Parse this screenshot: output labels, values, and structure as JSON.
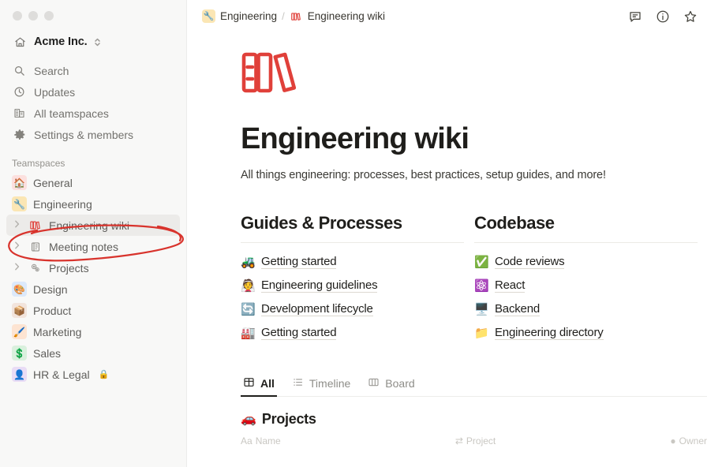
{
  "window": {
    "traffic_lights": [
      "close",
      "minimize",
      "maximize"
    ]
  },
  "sidebar": {
    "workspace": {
      "name": "Acme Inc.",
      "icon": "house-icon",
      "switcher_icon": "chevron-updown-icon"
    },
    "nav": [
      {
        "label": "Search",
        "icon": "search-icon"
      },
      {
        "label": "Updates",
        "icon": "clock-icon"
      },
      {
        "label": "All teamspaces",
        "icon": "buildings-icon"
      },
      {
        "label": "Settings & members",
        "icon": "gear-icon"
      }
    ],
    "teamspaces_label": "Teamspaces",
    "teamspaces": [
      {
        "label": "General",
        "emoji": "🏠",
        "badge_color": "#fce0de",
        "caret": false,
        "selected": false,
        "locked": false
      },
      {
        "label": "Engineering",
        "emoji": "🔧",
        "badge_color": "#fbe6b4",
        "caret": false,
        "selected": false,
        "locked": false
      },
      {
        "label": "Engineering wiki",
        "emoji": "📚",
        "badge_color": "",
        "caret": true,
        "selected": true,
        "locked": false
      },
      {
        "label": "Meeting notes",
        "emoji": "📔",
        "badge_color": "",
        "caret": true,
        "selected": false,
        "locked": false
      },
      {
        "label": "Projects",
        "emoji": "⚙️",
        "badge_color": "",
        "caret": true,
        "selected": false,
        "locked": false
      },
      {
        "label": "Design",
        "emoji": "🎨",
        "badge_color": "#dce9fb",
        "caret": false,
        "selected": false,
        "locked": false
      },
      {
        "label": "Product",
        "emoji": "📦",
        "badge_color": "#f2e4dc",
        "caret": false,
        "selected": false,
        "locked": false
      },
      {
        "label": "Marketing",
        "emoji": "🖌️",
        "badge_color": "#fde4d2",
        "caret": false,
        "selected": false,
        "locked": false
      },
      {
        "label": "Sales",
        "emoji": "💲",
        "badge_color": "#d9f0dd",
        "caret": false,
        "selected": false,
        "locked": false
      },
      {
        "label": "HR & Legal",
        "emoji": "👤",
        "badge_color": "#e9dcf5",
        "caret": false,
        "selected": false,
        "locked": true
      }
    ]
  },
  "annotation": {
    "shape": "hand-drawn-ellipse",
    "color": "#d8332c",
    "targets": "Engineering wiki sidebar item"
  },
  "topbar": {
    "breadcrumb": [
      {
        "label": "Engineering",
        "emoji": "🔧",
        "badge_color": "#fbe6b4"
      },
      {
        "label": "Engineering wiki",
        "emoji": "📚",
        "badge_color": ""
      }
    ],
    "separator": "/",
    "icons": [
      {
        "name": "comment-icon"
      },
      {
        "name": "info-icon"
      },
      {
        "name": "star-icon"
      }
    ]
  },
  "page": {
    "icon": "red-books-icon",
    "title": "Engineering wiki",
    "description": "All things engineering: processes, best practices, setup guides, and more!"
  },
  "columns": [
    {
      "heading": "Guides & Processes",
      "links": [
        {
          "label": "Getting started",
          "emoji": "🚜"
        },
        {
          "label": "Engineering guidelines",
          "emoji": "👰"
        },
        {
          "label": "Development lifecycle",
          "emoji": "🔄"
        },
        {
          "label": "Getting started",
          "emoji": "🏭"
        }
      ]
    },
    {
      "heading": "Codebase",
      "links": [
        {
          "label": "Code reviews",
          "emoji": "✅"
        },
        {
          "label": "React",
          "emoji": "⚛️"
        },
        {
          "label": "Backend",
          "emoji": "🖥️"
        },
        {
          "label": "Engineering directory",
          "emoji": "📁"
        }
      ]
    }
  ],
  "database": {
    "tabs": [
      {
        "label": "All",
        "icon": "grid-icon",
        "active": true
      },
      {
        "label": "Timeline",
        "icon": "timeline-icon",
        "active": false
      },
      {
        "label": "Board",
        "icon": "board-icon",
        "active": false
      }
    ],
    "title": "Projects",
    "title_emoji": "🚗",
    "columns": [
      {
        "label": "Name",
        "icon": "text-icon"
      },
      {
        "label": "Project",
        "icon": "relation-icon"
      },
      {
        "label": "Owner",
        "icon": "person-icon"
      }
    ]
  }
}
